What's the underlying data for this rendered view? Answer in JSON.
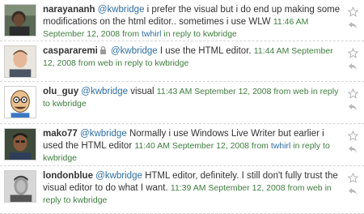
{
  "tweets": [
    {
      "user": "narayananh",
      "protected": false,
      "mention": "@kwbridge",
      "text": " i prefer the visual but i do end up making some modifications on the html editor.. sometimes i use WLW ",
      "time": "11:46 AM September 12, 2008",
      "from_label": " from ",
      "source": "twhirl",
      "reply_prefix": " in reply to ",
      "reply_to": "kwbridge",
      "avatar_icon": "avatar-photo-icon"
    },
    {
      "user": "caspararemi",
      "protected": true,
      "mention": "@kwbridge",
      "text": " I use the HTML editor. ",
      "time": "11:44 AM September 12, 2008",
      "from_label": " from web",
      "source": "",
      "reply_prefix": " in reply to ",
      "reply_to": "kwbridge",
      "avatar_icon": "avatar-photo-icon"
    },
    {
      "user": "olu_guy",
      "protected": false,
      "mention": "@kwbridge",
      "text": " visual ",
      "time": "11:43 AM September 12, 2008",
      "from_label": " from web",
      "source": "",
      "reply_prefix": " in reply to ",
      "reply_to": "kwbridge",
      "avatar_icon": "avatar-cartoon-icon"
    },
    {
      "user": "mako77",
      "protected": false,
      "mention": "@kwbridge",
      "text": " Normally i use Windows Live Writer but earlier i used the HTML editor ",
      "time": "11:40 AM September 12, 2008",
      "from_label": " from ",
      "source": "twhirl",
      "reply_prefix": " in reply to ",
      "reply_to": "kwbridge",
      "avatar_icon": "avatar-photo-icon"
    },
    {
      "user": "londonblue",
      "protected": false,
      "mention": "@kwbridge",
      "text": " HTML editor, definitely. I still don't fully trust the visual editor to do what I want. ",
      "time": "11:39 AM September 12, 2008",
      "from_label": " from web",
      "source": "",
      "reply_prefix": " in reply to ",
      "reply_to": "kwbridge",
      "avatar_icon": "avatar-photo-icon"
    }
  ],
  "colors": {
    "username": "#333333",
    "link": "#2d6ea3",
    "meta": "#3e7d3e",
    "separator": "#d4d4d4"
  }
}
